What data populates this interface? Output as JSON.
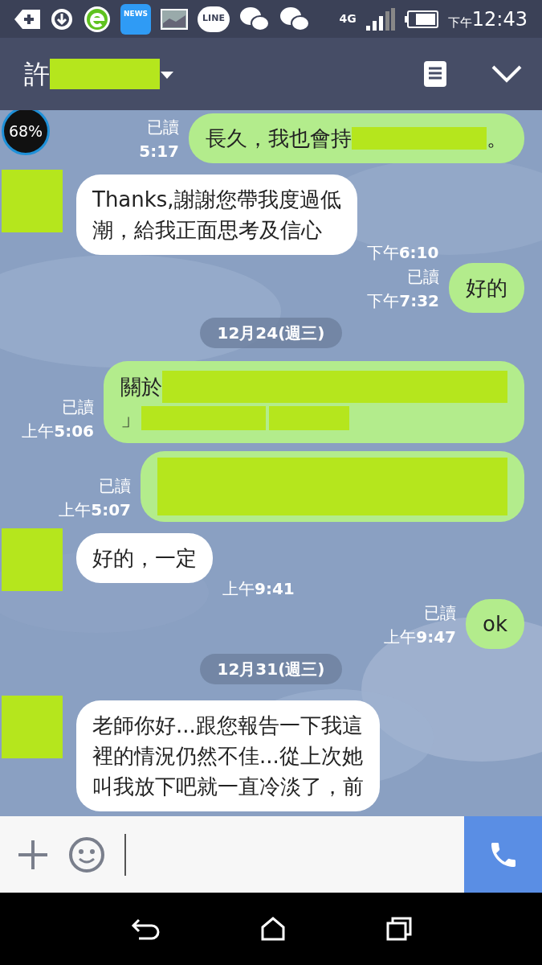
{
  "status_bar": {
    "news_label": "NEWS",
    "line_label": "LINE",
    "network": "4G",
    "time_prefix": "下午",
    "time": "12:43"
  },
  "header": {
    "title": "許",
    "title_redacted": true
  },
  "battery_widget": "68%",
  "messages": [
    {
      "kind": "outgoing",
      "read": "已讀",
      "time": "**5:17**",
      "lines": [
        [
          {
            "kind": "text",
            "text": "長久，我也會持"
          },
          {
            "kind": "medium"
          },
          {
            "kind": "text",
            "text": "。"
          }
        ]
      ]
    },
    {
      "kind": "incoming",
      "avatar_redacted": true,
      "time": "下午**6:10**",
      "lines": [
        [
          {
            "kind": "text",
            "text": "Thanks,謝謝您帶我度過低"
          }
        ],
        [
          {
            "kind": "text",
            "text": "潮，給我正面思考及信心"
          }
        ]
      ]
    },
    {
      "kind": "outgoing",
      "read": "已讀",
      "time": "下午**7:32**",
      "lines": [
        [
          {
            "kind": "text",
            "text": "好的"
          }
        ]
      ]
    },
    {
      "kind": "date",
      "text": "12月24(週三)"
    },
    {
      "kind": "outgoing",
      "read": "已讀",
      "time": "上午**5:06**",
      "lines": [
        [
          {
            "kind": "text",
            "text": "關於"
          },
          {
            "kind": "large"
          }
        ],
        [
          {
            "kind": "text",
            "text": "」"
          },
          {
            "kind": "small"
          },
          {
            "kind": "tiny"
          }
        ]
      ]
    },
    {
      "kind": "outgoing",
      "read": "已讀",
      "time": "上午**5:07**",
      "lines": [
        [
          {
            "kind": "block"
          }
        ]
      ]
    },
    {
      "kind": "incoming",
      "avatar_redacted": true,
      "time": "上午**9:41**",
      "lines": [
        [
          {
            "kind": "text",
            "text": "好的，一定"
          }
        ]
      ]
    },
    {
      "kind": "outgoing",
      "read": "已讀",
      "time": "上午**9:47**",
      "lines": [
        [
          {
            "kind": "text",
            "text": "ok"
          }
        ]
      ]
    },
    {
      "kind": "date",
      "text": "12月31(週三)"
    },
    {
      "kind": "incoming",
      "avatar_redacted": true,
      "lines": [
        [
          {
            "kind": "text",
            "text": "老師你好...跟您報告一下我這"
          }
        ],
        [
          {
            "kind": "text",
            "text": "裡的情況仍然不佳...從上次她"
          }
        ],
        [
          {
            "kind": "text",
            "text": "叫我放下吧就一直冷淡了，前"
          }
        ]
      ]
    }
  ]
}
